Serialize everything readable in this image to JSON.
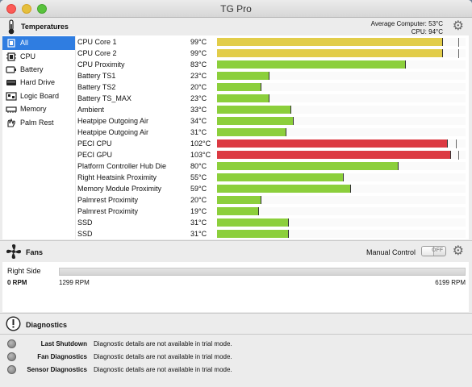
{
  "window": {
    "title": "TG Pro"
  },
  "temperatures": {
    "header": "Temperatures",
    "average_label": "Average Computer:",
    "average_value": "53°C",
    "cpu_label": "CPU:",
    "cpu_value": "94°C"
  },
  "sidebar": {
    "items": [
      {
        "label": "All",
        "icon": "all-icon"
      },
      {
        "label": "CPU",
        "icon": "cpu-icon"
      },
      {
        "label": "Battery",
        "icon": "battery-icon"
      },
      {
        "label": "Hard Drive",
        "icon": "hard-drive-icon"
      },
      {
        "label": "Logic Board",
        "icon": "logic-board-icon"
      },
      {
        "label": "Memory",
        "icon": "memory-icon"
      },
      {
        "label": "Palm Rest",
        "icon": "palm-rest-icon"
      }
    ]
  },
  "sensors": [
    {
      "name": "CPU Core 1",
      "value": "99°C",
      "level": 0.91,
      "peak": 0.97,
      "status": "warn"
    },
    {
      "name": "CPU Core 2",
      "value": "99°C",
      "level": 0.91,
      "peak": 0.97,
      "status": "warn"
    },
    {
      "name": "CPU Proximity",
      "value": "83°C",
      "level": 0.76,
      "status": "ok"
    },
    {
      "name": "Battery TS1",
      "value": "23°C",
      "level": 0.21,
      "status": "ok"
    },
    {
      "name": "Battery TS2",
      "value": "20°C",
      "level": 0.18,
      "status": "ok"
    },
    {
      "name": "Battery TS_MAX",
      "value": "23°C",
      "level": 0.21,
      "status": "ok"
    },
    {
      "name": "Ambient",
      "value": "33°C",
      "level": 0.3,
      "status": "ok"
    },
    {
      "name": "Heatpipe Outgoing Air",
      "value": "34°C",
      "level": 0.31,
      "status": "ok"
    },
    {
      "name": "Heatpipe Outgoing Air",
      "value": "31°C",
      "level": 0.28,
      "status": "ok"
    },
    {
      "name": "PECI CPU",
      "value": "102°C",
      "level": 0.93,
      "peak": 0.96,
      "status": "hot"
    },
    {
      "name": "PECI GPU",
      "value": "103°C",
      "level": 0.94,
      "peak": 0.97,
      "status": "hot"
    },
    {
      "name": "Platform Controller Hub Die",
      "value": "80°C",
      "level": 0.73,
      "status": "ok"
    },
    {
      "name": "Right Heatsink Proximity",
      "value": "55°C",
      "level": 0.51,
      "status": "ok"
    },
    {
      "name": "Memory Module Proximity",
      "value": "59°C",
      "level": 0.54,
      "status": "ok"
    },
    {
      "name": "Palmrest Proximity",
      "value": "20°C",
      "level": 0.18,
      "status": "ok"
    },
    {
      "name": "Palmrest Proximity",
      "value": "19°C",
      "level": 0.17,
      "status": "ok"
    },
    {
      "name": "SSD",
      "value": "31°C",
      "level": 0.29,
      "status": "ok"
    },
    {
      "name": "SSD",
      "value": "31°C",
      "level": 0.29,
      "status": "ok"
    }
  ],
  "fans": {
    "header": "Fans",
    "manual_control_label": "Manual Control",
    "toggle_label": "OFF",
    "fan_name": "Right Side",
    "current_rpm": "0 RPM",
    "min_rpm": "1299 RPM",
    "max_rpm": "6199 RPM",
    "level": 0.0
  },
  "diagnostics": {
    "header": "Diagnostics",
    "items": [
      {
        "label": "Last Shutdown",
        "message": "Diagnostic details are not available in trial mode."
      },
      {
        "label": "Fan Diagnostics",
        "message": "Diagnostic details are not available in trial mode."
      },
      {
        "label": "Sensor Diagnostics",
        "message": "Diagnostic details are not available in trial mode."
      }
    ]
  },
  "colors": {
    "ok": "#8ccf3c",
    "warn": "#e2cd4a",
    "hot": "#dc3a42",
    "selection": "#2f7de1"
  }
}
